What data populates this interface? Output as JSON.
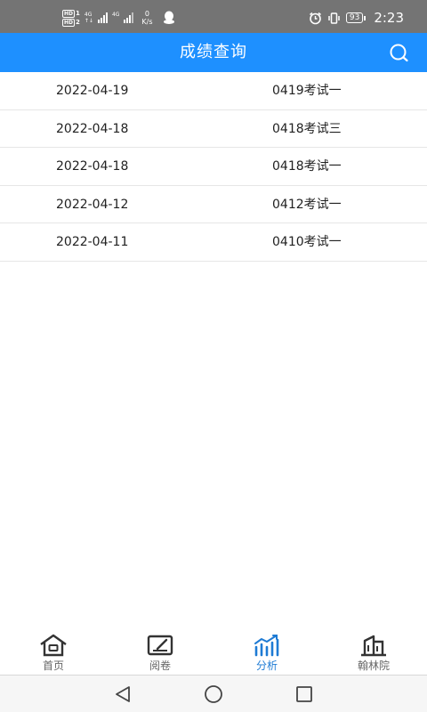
{
  "status_bar": {
    "hd1": "HD",
    "hd1_num": "1",
    "hd2": "HD",
    "hd2_num": "2",
    "net1_top": "4G",
    "net1_bottom": "↑↓",
    "net2_top": "4G",
    "speed_value": "0",
    "speed_unit": "K/s",
    "battery": "93",
    "time": "2:23",
    "icons": [
      "hd-icon",
      "signal-icon",
      "qq-icon",
      "alarm-icon",
      "vibrate-icon",
      "battery-icon"
    ]
  },
  "header": {
    "title": "成绩查询",
    "search_icon": "search-icon",
    "background": "#1e90ff"
  },
  "results": [
    {
      "date": "2022-04-19",
      "name": "0419考试一"
    },
    {
      "date": "2022-04-18",
      "name": "0418考试三"
    },
    {
      "date": "2022-04-18",
      "name": "0418考试一"
    },
    {
      "date": "2022-04-12",
      "name": "0412考试一"
    },
    {
      "date": "2022-04-11",
      "name": "0410考试一"
    }
  ],
  "tabs": [
    {
      "label": "首页",
      "icon": "home-icon",
      "active": false
    },
    {
      "label": "阅卷",
      "icon": "edit-paper-icon",
      "active": false
    },
    {
      "label": "分析",
      "icon": "chart-icon",
      "active": true
    },
    {
      "label": "翰林院",
      "icon": "building-icon",
      "active": false
    }
  ],
  "nav": {
    "back_icon": "back-triangle-icon",
    "home_icon": "home-circle-icon",
    "recents_icon": "recents-square-icon"
  },
  "colors": {
    "accent": "#1e90ff",
    "active_tab": "#1e7bd4",
    "status_bar": "#747474"
  }
}
